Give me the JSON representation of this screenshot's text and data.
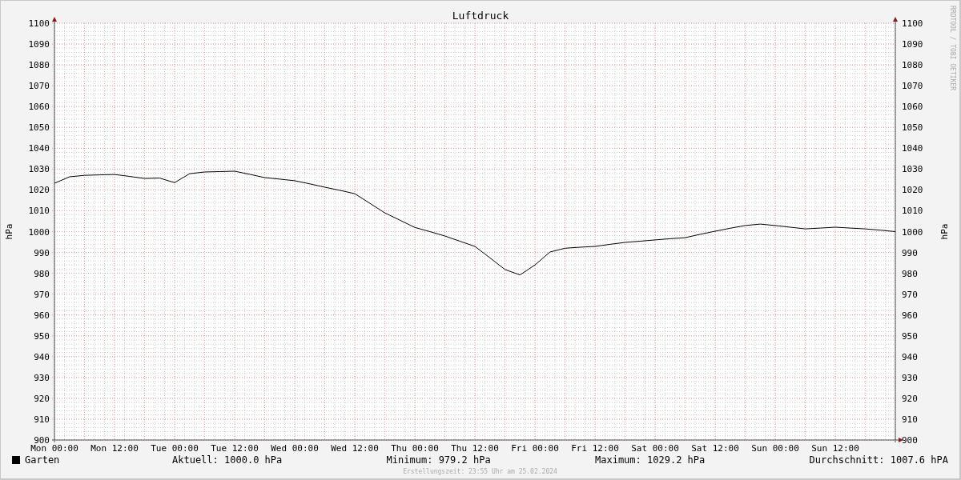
{
  "chart_data": {
    "type": "line",
    "title": "Luftdruck",
    "grid": true,
    "ylabel": "hPa",
    "ylim": [
      900,
      1100
    ],
    "categories": [
      "Mon 00:00",
      null,
      null,
      null,
      "Mon 12:00",
      null,
      null,
      null,
      "Tue 00:00",
      null,
      null,
      null,
      "Tue 12:00",
      null,
      null,
      null,
      "Wed 00:00",
      null,
      null,
      null,
      "Wed 12:00",
      null,
      null,
      null,
      "Thu 00:00",
      null,
      null,
      null,
      "Thu 12:00",
      null,
      null,
      null,
      "Fri 00:00",
      null,
      null,
      null,
      "Fri 12:00",
      null,
      null,
      null,
      "Sat 00:00",
      null,
      null,
      null,
      "Sat 12:00",
      null,
      null,
      null,
      "Sun 00:00",
      null,
      null,
      null,
      "Sun 12:00",
      null,
      null,
      null,
      null
    ],
    "series": [
      {
        "name": "Garten",
        "color": "#000000",
        "values": [
          1023.2,
          1026.3,
          1027,
          1027.2,
          1027.4,
          1026.5,
          1025.5,
          1025.7,
          1023.5,
          1027.8,
          1028.6,
          1028.8,
          1029,
          1027.5,
          1025.9,
          1025.2,
          1024.4,
          1022.9,
          1021.3,
          1019.8,
          1018.2,
          1013.6,
          1009,
          1005.5,
          1002,
          1000,
          997.9,
          995.4,
          992.9,
          987.4,
          981.8,
          979.2,
          984,
          990.2,
          992,
          992.5,
          992.9,
          993.9,
          994.8,
          995.4,
          996,
          996.6,
          997.1,
          998.7,
          1000.2,
          1001.6,
          1002.9,
          1003.6,
          1002.9,
          1002.1,
          1001.3,
          1001.7,
          1002.1,
          1001.7,
          1001.3,
          1000.7,
          1000
        ]
      }
    ],
    "yticks": [
      1100,
      1090,
      1080,
      1070,
      1060,
      1050,
      1040,
      1030,
      1020,
      1010,
      1000,
      990,
      980,
      970,
      960,
      950,
      940,
      930,
      920,
      910,
      900
    ]
  },
  "right_axis": {
    "ylabel": "hPa",
    "labels": [
      "1100",
      "1090",
      "1080",
      "1070",
      "1060",
      "1050",
      "1040",
      "1030",
      "1020",
      "1010",
      "1000",
      "990",
      "980",
      "970",
      "960",
      "950",
      "940",
      "930",
      "920",
      "910",
      "900"
    ]
  },
  "watermark_label": "RRDTOOL / TOBI OETIKER",
  "legend": {
    "stats": [
      "Aktuell: 1000.0 hPa",
      "Minimum: 979.2 hPa",
      "Maximum: 1029.2 hPa",
      "Durchschnitt: 1007.6 hPA"
    ]
  },
  "footer": "Erstellungszeit: 23:55 Uhr am 25.02.2024"
}
